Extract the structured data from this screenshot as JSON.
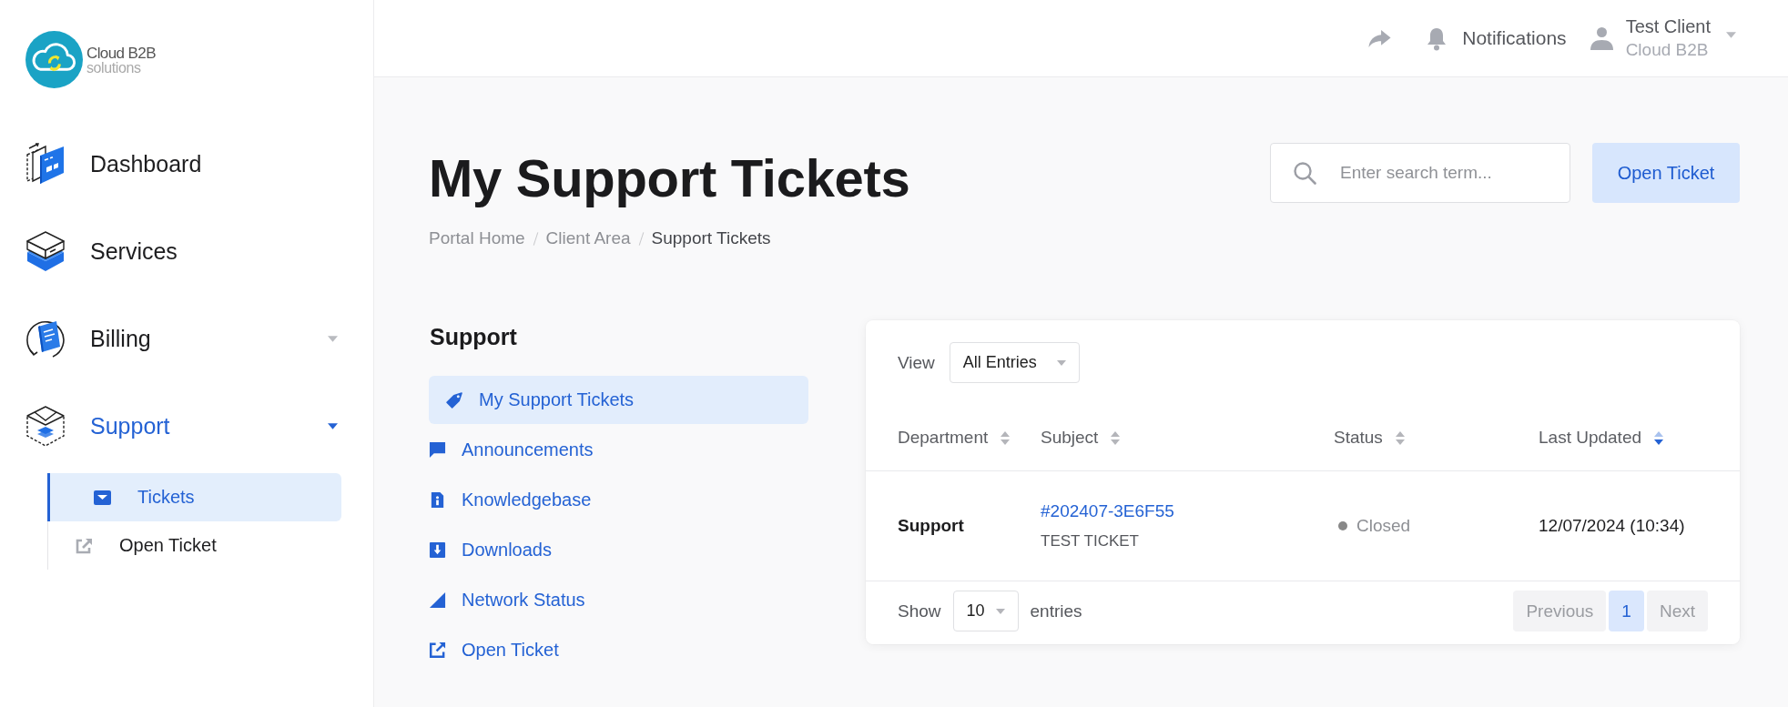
{
  "logo": {
    "name": "Cloud B2B",
    "tagline": "solutions"
  },
  "sidebar": {
    "items": [
      {
        "label": "Dashboard",
        "selected": false,
        "caret": false
      },
      {
        "label": "Services",
        "selected": false,
        "caret": false
      },
      {
        "label": "Billing",
        "selected": false,
        "caret": true
      },
      {
        "label": "Support",
        "selected": true,
        "caret": true,
        "children": [
          {
            "label": "Tickets",
            "selected": true
          },
          {
            "label": "Open Ticket",
            "selected": false
          }
        ]
      }
    ]
  },
  "topbar": {
    "notifications": "Notifications",
    "user": {
      "name": "Test Client",
      "company": "Cloud B2B"
    }
  },
  "page": {
    "title": "My Support Tickets",
    "breadcrumb": [
      {
        "label": "Portal Home",
        "current": false
      },
      {
        "label": "Client Area",
        "current": false
      },
      {
        "label": "Support Tickets",
        "current": true
      }
    ],
    "search": {
      "placeholder": "Enter search term..."
    },
    "action_button": "Open Ticket"
  },
  "support_menu": {
    "title": "Support",
    "items": [
      {
        "label": "My Support Tickets",
        "selected": true
      },
      {
        "label": "Announcements",
        "selected": false
      },
      {
        "label": "Knowledgebase",
        "selected": false
      },
      {
        "label": "Downloads",
        "selected": false
      },
      {
        "label": "Network Status",
        "selected": false
      },
      {
        "label": "Open Ticket",
        "selected": false
      }
    ]
  },
  "tickets_table": {
    "view_label": "View",
    "view_filter": "All Entries",
    "columns": [
      {
        "label": "Department",
        "sorted": false
      },
      {
        "label": "Subject",
        "sorted": false
      },
      {
        "label": "Status",
        "sorted": false
      },
      {
        "label": "Last Updated",
        "sorted": true
      }
    ],
    "rows": [
      {
        "department": "Support",
        "ticket_id": "#202407-3E6F55",
        "subject": "TEST TICKET",
        "status": "Closed",
        "color": "#888888",
        "last_updated": "12/07/2024 (10:34)"
      }
    ],
    "footer": {
      "show_label": "Show",
      "page_size": "10",
      "entries_label": "entries",
      "pagination": [
        {
          "label": "Previous",
          "selected": false,
          "disabled": true
        },
        {
          "label": "1",
          "selected": true,
          "disabled": false
        },
        {
          "label": "Next",
          "selected": false,
          "disabled": true
        }
      ]
    }
  }
}
